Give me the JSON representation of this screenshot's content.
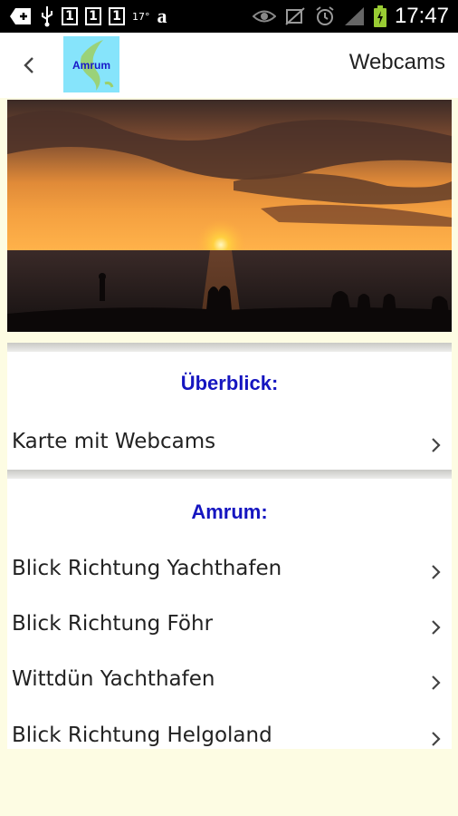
{
  "status_bar": {
    "box_digits": [
      "1",
      "1",
      "1"
    ],
    "temperature": "17°",
    "amazon_glyph": "a",
    "time": "17:47",
    "icons": [
      "add-icon",
      "usb-icon",
      "amazon-icon",
      "eye-icon",
      "mute-icon",
      "alarm-icon",
      "signal-icon",
      "battery-icon"
    ]
  },
  "app_bar": {
    "logo_text": "Amrum",
    "title": "Webcams"
  },
  "hero": {
    "description": "sunset-over-sea-photo"
  },
  "sections": [
    {
      "title": "Überblick:",
      "items": [
        {
          "label": "Karte mit Webcams"
        }
      ]
    },
    {
      "title": "Amrum:",
      "items": [
        {
          "label": "Blick Richtung Yachthafen"
        },
        {
          "label": "Blick Richtung Föhr"
        },
        {
          "label": "Wittdün Yachthafen"
        },
        {
          "label": "Blick Richtung Helgoland"
        }
      ]
    }
  ],
  "colors": {
    "section_title": "#1515C0",
    "logo_bg": "#86E4FB",
    "page_bg": "#FDFCE3"
  }
}
